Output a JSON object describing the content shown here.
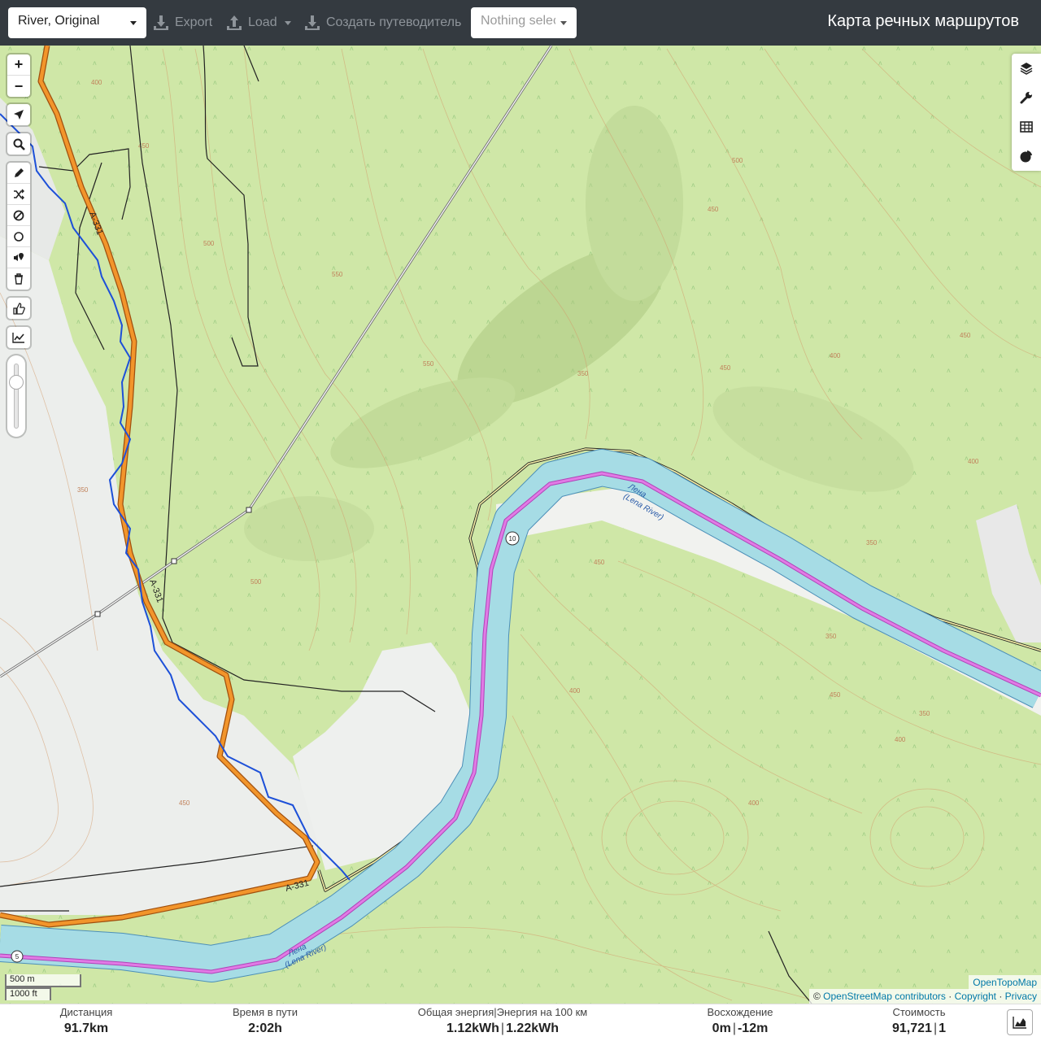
{
  "header": {
    "profile_select": "River, Original",
    "export_label": "Export",
    "load_label": "Load",
    "guide_label": "Создать путеводитель",
    "track_select_placeholder": "Nothing selected",
    "title": "Карта речных маршрутов"
  },
  "map": {
    "zoom_in": "+",
    "zoom_out": "−",
    "road_labels": [
      "A-331",
      "A-331",
      "A-331"
    ],
    "river_name_1": "Лена",
    "river_name_2": "(Lena River)",
    "route_markers": [
      "10",
      "5"
    ],
    "contour_labels": [
      "400",
      "450",
      "500",
      "550",
      "350",
      "450",
      "500",
      "400",
      "450",
      "350",
      "400",
      "450",
      "500",
      "550",
      "450",
      "400",
      "350",
      "400",
      "450",
      "350",
      "400",
      "450",
      "350"
    ],
    "scale_metric": "500 m",
    "scale_imperial": "1000 ft",
    "attribution_layer": "OpenTopoMap",
    "attribution_prefix": "©",
    "attribution_osm": "OpenStreetMap contributors",
    "attribution_sep": "·",
    "attribution_copyright": "Copyright",
    "attribution_privacy": "Privacy"
  },
  "toolbar_left": {
    "tools": [
      "locate-icon",
      "search-icon",
      "draw-icon",
      "shuffle-icon",
      "block-icon",
      "circle-icon",
      "voice-pin-icon",
      "trash-icon",
      "thumb-icon",
      "elevation-icon"
    ]
  },
  "toolbar_right": {
    "tools": [
      "layers-icon",
      "wrench-icon",
      "table-icon",
      "pie-chart-icon"
    ]
  },
  "stats": {
    "distance": {
      "label": "Дистанция",
      "value": "91.7",
      "unit": "km"
    },
    "time": {
      "label": "Время в пути",
      "value": "2:02",
      "unit": "h"
    },
    "energy": {
      "label": "Общая энергия | Энергия на 100 км",
      "label_a": "Общая энергия",
      "label_b": "Энергия на 100 км",
      "value_a": "1.12",
      "unit_a": "kWh",
      "value_b": "1.22",
      "unit_b": "kWh"
    },
    "ascent": {
      "label_text": "Восхождение",
      "value_a": "0",
      "unit_a": "m",
      "value_b": "-12",
      "unit_b": "m"
    },
    "cost": {
      "label": "Стоимость",
      "value_a": "91,721",
      "value_b": "1"
    }
  },
  "colors": {
    "topbar": "#343a40",
    "forest": "#cfe7a7",
    "river": "#a6dce5",
    "route": "#e17ae5",
    "road": "#f2952b",
    "stream": "#1d50d8"
  }
}
